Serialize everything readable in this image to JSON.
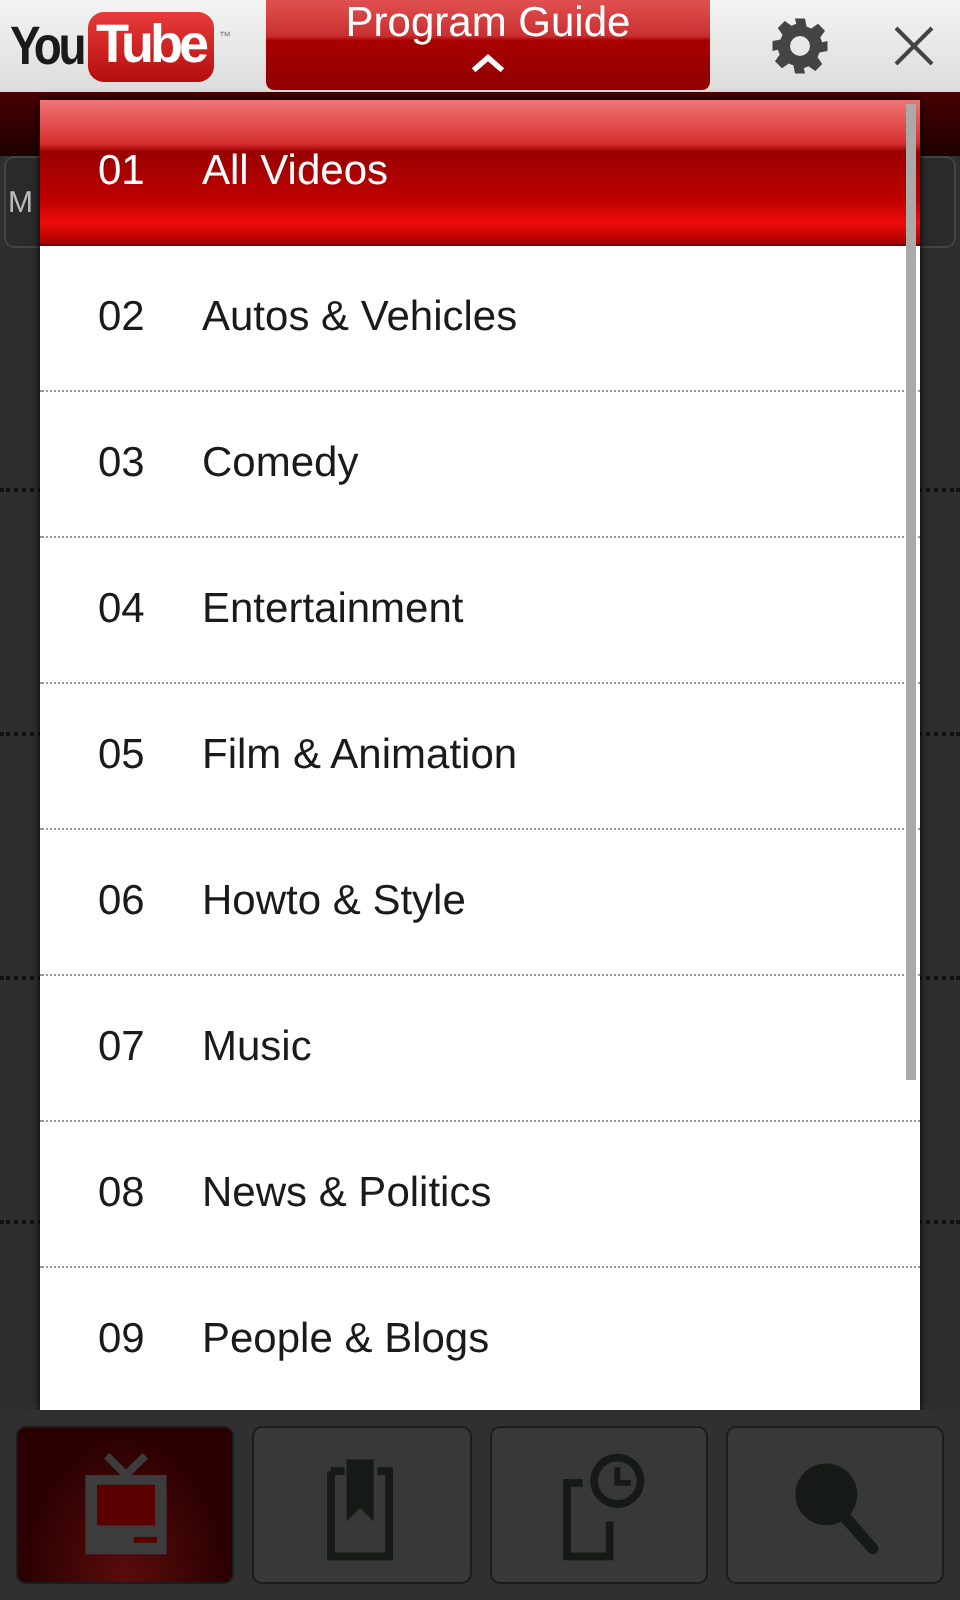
{
  "header": {
    "logo_text": "You",
    "logo_box_text": "Tube",
    "logo_mark": "™",
    "guide_button": {
      "label": "Program Guide",
      "expanded": true
    }
  },
  "background": {
    "field_text": "M"
  },
  "guide": [
    {
      "number": "01",
      "label": "All Videos",
      "selected": true
    },
    {
      "number": "02",
      "label": "Autos & Vehicles",
      "selected": false
    },
    {
      "number": "03",
      "label": "Comedy",
      "selected": false
    },
    {
      "number": "04",
      "label": "Entertainment",
      "selected": false
    },
    {
      "number": "05",
      "label": "Film & Animation",
      "selected": false
    },
    {
      "number": "06",
      "label": "Howto & Style",
      "selected": false
    },
    {
      "number": "07",
      "label": "Music",
      "selected": false
    },
    {
      "number": "08",
      "label": "News & Politics",
      "selected": false
    },
    {
      "number": "09",
      "label": "People & Blogs",
      "selected": false
    }
  ],
  "bottom_tabs": [
    {
      "kind": "tv",
      "selected": true
    },
    {
      "kind": "bookmark",
      "selected": false
    },
    {
      "kind": "history",
      "selected": false
    },
    {
      "kind": "search",
      "selected": false
    }
  ]
}
